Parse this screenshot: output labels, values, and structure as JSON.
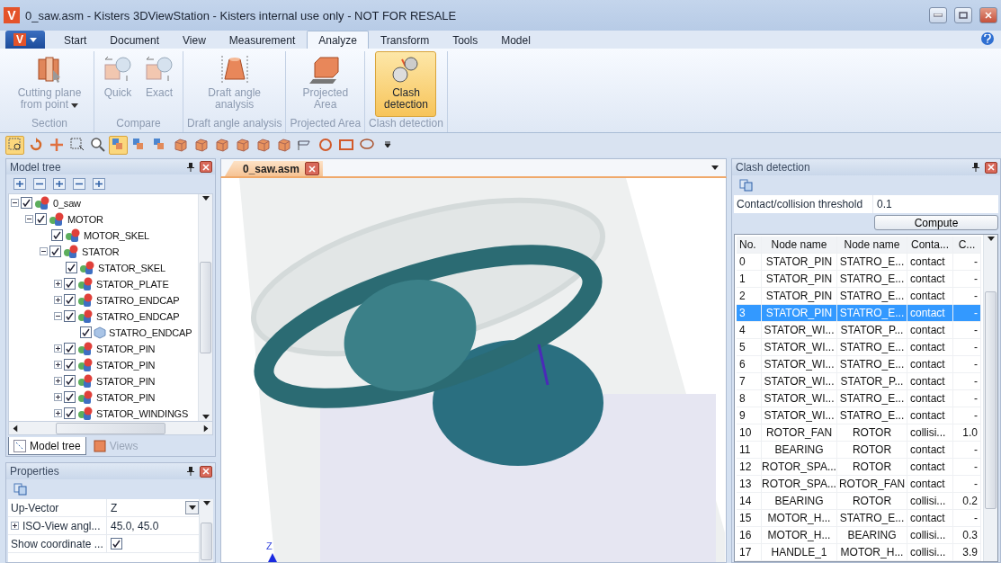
{
  "window": {
    "logo": "V",
    "title": "0_saw.asm - Kisters 3DViewStation - Kisters internal use only - NOT FOR RESALE"
  },
  "app_button": {
    "logo": "V"
  },
  "menu_tabs": [
    {
      "label": "Start",
      "selected": false
    },
    {
      "label": "Document",
      "selected": false
    },
    {
      "label": "View",
      "selected": false
    },
    {
      "label": "Measurement",
      "selected": false
    },
    {
      "label": "Analyze",
      "selected": true
    },
    {
      "label": "Transform",
      "selected": false
    },
    {
      "label": "Tools",
      "selected": false
    },
    {
      "label": "Model",
      "selected": false
    }
  ],
  "ribbon_groups": [
    {
      "title": "Section",
      "buttons": [
        {
          "label": "Cutting plane from point",
          "kind": "cutting",
          "disabled": true,
          "selected": false,
          "dropdown": true
        }
      ]
    },
    {
      "title": "Compare",
      "buttons": [
        {
          "label": "Quick",
          "kind": "compare",
          "disabled": true,
          "selected": false,
          "dropdown": false
        },
        {
          "label": "Exact",
          "kind": "compare",
          "disabled": true,
          "selected": false,
          "dropdown": false
        }
      ]
    },
    {
      "title": "Draft angle analysis",
      "buttons": [
        {
          "label": "Draft angle analysis",
          "kind": "draft",
          "disabled": true,
          "selected": false,
          "dropdown": false
        }
      ]
    },
    {
      "title": "Projected Area",
      "buttons": [
        {
          "label": "Projected Area",
          "kind": "projected",
          "disabled": true,
          "selected": false,
          "dropdown": false
        }
      ]
    },
    {
      "title": "Clash detection",
      "buttons": [
        {
          "label": "Clash detection",
          "kind": "clash",
          "disabled": false,
          "selected": true,
          "dropdown": false
        }
      ]
    }
  ],
  "toolbar": [
    {
      "kind": "select",
      "selected": true
    },
    {
      "kind": "rotate",
      "selected": false
    },
    {
      "kind": "move",
      "selected": false
    },
    {
      "kind": "frame",
      "selected": false
    },
    {
      "kind": "zoom",
      "selected": false
    },
    {
      "kind": "pick",
      "selected": true
    },
    {
      "kind": "pick",
      "selected": false
    },
    {
      "kind": "pick",
      "selected": false
    },
    {
      "kind": "cube",
      "selected": false
    },
    {
      "kind": "cube",
      "selected": false
    },
    {
      "kind": "cube",
      "selected": false
    },
    {
      "kind": "cube",
      "selected": false
    },
    {
      "kind": "cube",
      "selected": false
    },
    {
      "kind": "cube",
      "selected": false
    },
    {
      "kind": "flag",
      "selected": false
    },
    {
      "kind": "circle",
      "selected": false
    },
    {
      "kind": "rect",
      "selected": false
    },
    {
      "kind": "lasso",
      "selected": false
    },
    {
      "kind": "more",
      "selected": false
    }
  ],
  "model_tree": {
    "title": "Model tree",
    "items": [
      {
        "label": "0_saw",
        "kind": "assembly",
        "checked": true,
        "expanded": true,
        "children": [
          {
            "label": "MOTOR",
            "kind": "assembly",
            "checked": true,
            "expanded": true,
            "children": [
              {
                "label": "MOTOR_SKEL",
                "kind": "assembly",
                "checked": true
              },
              {
                "label": "STATOR",
                "kind": "assembly",
                "checked": true,
                "expanded": true,
                "children": [
                  {
                    "label": "STATOR_SKEL",
                    "kind": "assembly",
                    "checked": true
                  },
                  {
                    "label": "STATOR_PLATE",
                    "kind": "assembly",
                    "checked": true,
                    "expanded": false
                  },
                  {
                    "label": "STATRO_ENDCAP",
                    "kind": "assembly",
                    "checked": true,
                    "expanded": false
                  },
                  {
                    "label": "STATRO_ENDCAP",
                    "kind": "assembly",
                    "checked": true,
                    "expanded": true,
                    "children": [
                      {
                        "label": "STATRO_ENDCAP",
                        "kind": "part",
                        "checked": true
                      }
                    ]
                  },
                  {
                    "label": "STATOR_PIN",
                    "kind": "assembly",
                    "checked": true,
                    "expanded": false
                  },
                  {
                    "label": "STATOR_PIN",
                    "kind": "assembly",
                    "checked": true,
                    "expanded": false
                  },
                  {
                    "label": "STATOR_PIN",
                    "kind": "assembly",
                    "checked": true,
                    "expanded": false
                  },
                  {
                    "label": "STATOR_PIN",
                    "kind": "assembly",
                    "checked": true,
                    "expanded": false
                  },
                  {
                    "label": "STATOR_WINDINGS",
                    "kind": "assembly",
                    "checked": true,
                    "expanded": false
                  }
                ]
              }
            ]
          }
        ]
      }
    ]
  },
  "panel_tabs": [
    {
      "label": "Model tree",
      "selected": true
    },
    {
      "label": "Views",
      "selected": false
    }
  ],
  "properties": {
    "title": "Properties",
    "rows": [
      {
        "name": "Up-Vector",
        "kind": "dropdown",
        "value": "Z",
        "expanded": false
      },
      {
        "name": "ISO-View angl...",
        "kind": "text",
        "value": "45.0, 45.0",
        "expanded": false
      },
      {
        "name": "Show coordinate ...",
        "kind": "checkbox",
        "checked": true
      }
    ]
  },
  "document_tab": {
    "label": "0_saw.asm"
  },
  "viewport": {
    "axis_label": "Z"
  },
  "clash": {
    "title": "Clash detection",
    "threshold_label": "Contact/collision threshold",
    "threshold_value": "0.1",
    "compute": "Compute",
    "columns": [
      "No.",
      "Node name",
      "Node name",
      "Conta...",
      "C..."
    ],
    "rows": [
      {
        "cells": [
          "0",
          "STATOR_PIN",
          "STATRO_E...",
          "contact",
          "-"
        ],
        "selected": false
      },
      {
        "cells": [
          "1",
          "STATOR_PIN",
          "STATRO_E...",
          "contact",
          "-"
        ],
        "selected": false
      },
      {
        "cells": [
          "2",
          "STATOR_PIN",
          "STATRO_E...",
          "contact",
          "-"
        ],
        "selected": false
      },
      {
        "cells": [
          "3",
          "STATOR_PIN",
          "STATRO_E...",
          "contact",
          "-"
        ],
        "selected": true
      },
      {
        "cells": [
          "4",
          "STATOR_WI...",
          "STATOR_P...",
          "contact",
          "-"
        ],
        "selected": false
      },
      {
        "cells": [
          "5",
          "STATOR_WI...",
          "STATRO_E...",
          "contact",
          "-"
        ],
        "selected": false
      },
      {
        "cells": [
          "6",
          "STATOR_WI...",
          "STATRO_E...",
          "contact",
          "-"
        ],
        "selected": false
      },
      {
        "cells": [
          "7",
          "STATOR_WI...",
          "STATOR_P...",
          "contact",
          "-"
        ],
        "selected": false
      },
      {
        "cells": [
          "8",
          "STATOR_WI...",
          "STATRO_E...",
          "contact",
          "-"
        ],
        "selected": false
      },
      {
        "cells": [
          "9",
          "STATOR_WI...",
          "STATRO_E...",
          "contact",
          "-"
        ],
        "selected": false
      },
      {
        "cells": [
          "10",
          "ROTOR_FAN",
          "ROTOR",
          "collisi...",
          "1.0"
        ],
        "selected": false
      },
      {
        "cells": [
          "11",
          "BEARING",
          "ROTOR",
          "contact",
          "-"
        ],
        "selected": false
      },
      {
        "cells": [
          "12",
          "ROTOR_SPA...",
          "ROTOR",
          "contact",
          "-"
        ],
        "selected": false
      },
      {
        "cells": [
          "13",
          "ROTOR_SPA...",
          "ROTOR_FAN",
          "contact",
          "-"
        ],
        "selected": false
      },
      {
        "cells": [
          "14",
          "BEARING",
          "ROTOR",
          "collisi...",
          "0.2"
        ],
        "selected": false
      },
      {
        "cells": [
          "15",
          "MOTOR_H...",
          "STATRO_E...",
          "contact",
          "-"
        ],
        "selected": false
      },
      {
        "cells": [
          "16",
          "MOTOR_H...",
          "BEARING",
          "collisi...",
          "0.3"
        ],
        "selected": false
      },
      {
        "cells": [
          "17",
          "HANDLE_1",
          "MOTOR_H...",
          "collisi...",
          "3.9"
        ],
        "selected": false
      }
    ]
  }
}
